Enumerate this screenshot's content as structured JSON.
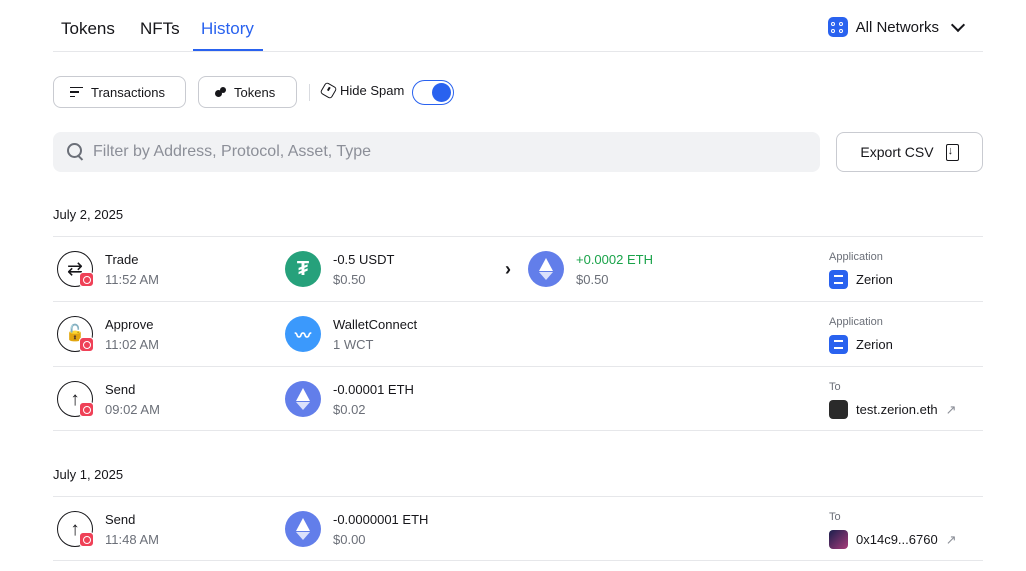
{
  "tabs": [
    {
      "label": "Tokens"
    },
    {
      "label": "NFTs"
    },
    {
      "label": "History",
      "active": true
    }
  ],
  "networks": {
    "label": "All Networks",
    "icon": "network-grid-icon"
  },
  "filters": {
    "transactions_label": "Transactions",
    "tokens_label": "Tokens",
    "hide_spam_label": "Hide Spam",
    "hide_spam_on": true
  },
  "search": {
    "placeholder": "Filter by Address, Protocol, Asset, Type",
    "value": ""
  },
  "export_label": "Export CSV",
  "colors": {
    "accent": "#2962ef",
    "positive": "#1aa34a",
    "badge": "#ef4157"
  },
  "groups": [
    {
      "date": "July 2, 2025",
      "items": [
        {
          "action": "Trade",
          "time": "11:52 AM",
          "icon": "swap-icon",
          "out": {
            "amount": "-0.5 USDT",
            "value": "$0.50",
            "token": "usdt-icon"
          },
          "in": {
            "amount": "+0.0002 ETH",
            "value": "$0.50",
            "token": "eth-icon"
          },
          "meta_label": "Application",
          "meta_value": "Zerion"
        },
        {
          "action": "Approve",
          "time": "11:02 AM",
          "icon": "unlock-icon",
          "out": {
            "amount": "WalletConnect",
            "value": "1 WCT",
            "token": "walletconnect-icon"
          },
          "meta_label": "Application",
          "meta_value": "Zerion"
        },
        {
          "action": "Send",
          "time": "09:02 AM",
          "icon": "send-arrow-icon",
          "out": {
            "amount": "-0.00001 ETH",
            "value": "$0.02",
            "token": "eth-icon"
          },
          "meta_label": "To",
          "meta_value": "test.zerion.eth"
        }
      ]
    },
    {
      "date": "July 1, 2025",
      "items": [
        {
          "action": "Send",
          "time": "11:48 AM",
          "icon": "send-arrow-icon",
          "out": {
            "amount": "-0.0000001 ETH",
            "value": "$0.00",
            "token": "eth-icon"
          },
          "meta_label": "To",
          "meta_value": "0x14c9...6760"
        }
      ]
    }
  ]
}
